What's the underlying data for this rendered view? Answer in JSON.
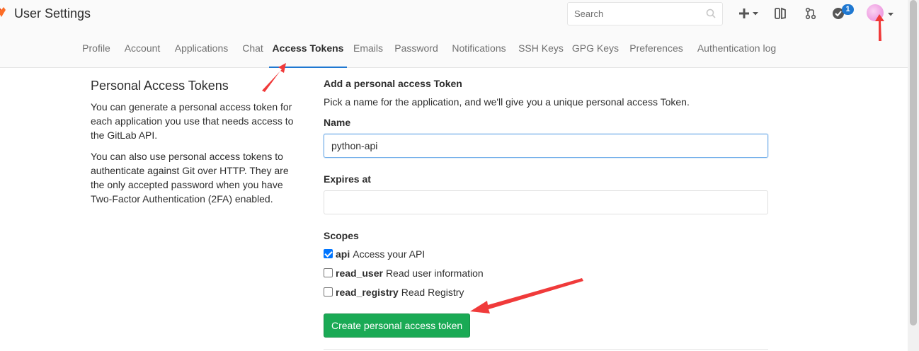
{
  "header": {
    "title": "User Settings",
    "search_placeholder": "Search",
    "todos_count": "1"
  },
  "tabs": [
    {
      "label": "Profile"
    },
    {
      "label": "Account"
    },
    {
      "label": "Applications"
    },
    {
      "label": "Chat"
    },
    {
      "label": "Access Tokens",
      "active": true
    },
    {
      "label": "Emails"
    },
    {
      "label": "Password"
    },
    {
      "label": "Notifications"
    },
    {
      "label": "SSH Keys"
    },
    {
      "label": "GPG Keys"
    },
    {
      "label": "Preferences"
    },
    {
      "label": "Authentication log"
    }
  ],
  "sidebar": {
    "heading": "Personal Access Tokens",
    "para1": "You can generate a personal access token for each application you use that needs access to the GitLab API.",
    "para2": "You can also use personal access tokens to authenticate against Git over HTTP. They are the only accepted password when you have Two-Factor Authentication (2FA) enabled."
  },
  "form": {
    "heading": "Add a personal access Token",
    "description": "Pick a name for the application, and we'll give you a unique personal access Token.",
    "name_label": "Name",
    "name_value": "python-api",
    "expires_label": "Expires at",
    "expires_value": "",
    "scopes_label": "Scopes",
    "scopes": [
      {
        "name": "api",
        "description": "Access your API",
        "checked": true
      },
      {
        "name": "read_user",
        "description": "Read user information",
        "checked": false
      },
      {
        "name": "read_registry",
        "description": "Read Registry",
        "checked": false
      }
    ],
    "submit_label": "Create personal access token"
  },
  "colors": {
    "accent": "#1f78d1",
    "submit": "#1aaa55",
    "annotation_arrow": "#f03a3a"
  },
  "icons": [
    "gitlab-logo-icon",
    "search-icon",
    "plus-icon",
    "issues-icon",
    "merge-request-icon",
    "todos-icon",
    "chevron-down-icon"
  ]
}
